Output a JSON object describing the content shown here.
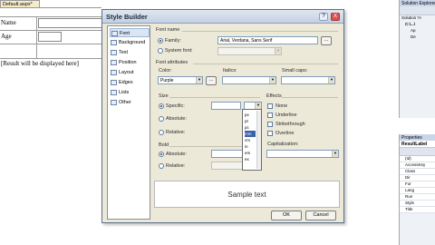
{
  "doc_tab": {
    "title": "Default.aspx*"
  },
  "form": {
    "name_label": "Name",
    "age_label": "Age",
    "result_text": "[Result will be displayed here]"
  },
  "solution_explorer": {
    "title": "Solution Explorer",
    "items": [
      "Solution 'H",
      "C:\\...\\",
      "Ap",
      "De"
    ]
  },
  "properties": {
    "title": "Properties",
    "object": "ResultLabel",
    "rows": [
      "(Id)",
      "AccessKey",
      "Class",
      "Dir",
      "For",
      "Lang",
      "Run",
      "Style",
      "Title"
    ]
  },
  "dialog": {
    "title": "Style Builder",
    "help_btn": "?",
    "close_btn": "X",
    "nav": [
      "Font",
      "Background",
      "Text",
      "Position",
      "Layout",
      "Edges",
      "Lists",
      "Other"
    ],
    "font_name_header": "Font name",
    "family_label": "Family:",
    "family_value": "Arial, Verdana, Sans Serif",
    "system_font_label": "System font:",
    "font_attributes_header": "Font attributes",
    "color_label": "Color:",
    "color_value": "Purple",
    "italics_label": "Italics:",
    "small_caps_label": "Small caps:",
    "size_header": "Size",
    "specific_label": "Specific:",
    "absolute_label": "Absolute:",
    "relative_label": "Relative:",
    "bold_header": "Bold",
    "bold_absolute_label": "Absolute:",
    "bold_relative_label": "Relative:",
    "effects_header": "Effects",
    "effects": [
      "None",
      "Underline",
      "Strikethrough",
      "Overline"
    ],
    "capitalization_header": "Capitalization:",
    "units_options": [
      "px",
      "pt",
      "pc",
      "mm",
      "cm",
      "in",
      "em",
      "ex"
    ],
    "units_selected": "mm",
    "sample_text": "Sample text",
    "ok_label": "OK",
    "cancel_label": "Cancel",
    "ellipsis": "..."
  }
}
